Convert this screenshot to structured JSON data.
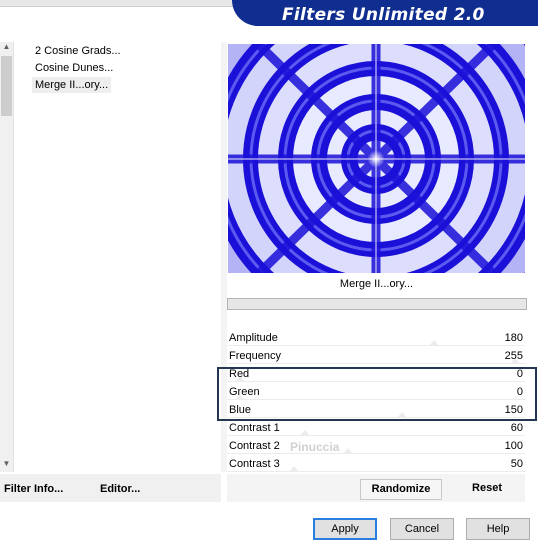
{
  "title": "Filters Unlimited 2.0",
  "filter_list": {
    "items": [
      {
        "label": "2 Cosine Grads..."
      },
      {
        "label": "Cosine Dunes..."
      },
      {
        "label": "Merge II...ory..."
      }
    ],
    "selected_index": 2
  },
  "preview": {
    "caption": "Merge II...ory...",
    "colors": {
      "dark": "#1a10d8",
      "light": "#e8eaff",
      "mid": "#5a5af0"
    }
  },
  "sliders": [
    {
      "label": "Amplitude",
      "value": "180",
      "level": 0.706
    },
    {
      "label": "Frequency",
      "value": "255",
      "level": 1.0
    },
    {
      "label": "Red",
      "value": "0",
      "level": 0.0
    },
    {
      "label": "Green",
      "value": "0",
      "level": 0.0
    },
    {
      "label": "Blue",
      "value": "150",
      "level": 0.588
    },
    {
      "label": "Contrast 1",
      "value": "60",
      "level": 0.235
    },
    {
      "label": "Contrast 2",
      "value": "100",
      "level": 0.392
    },
    {
      "label": "Contrast 3",
      "value": "50",
      "level": 0.196
    }
  ],
  "links": {
    "filter_info": "Filter Info...",
    "editor": "Editor..."
  },
  "actions": {
    "randomize": "Randomize",
    "reset": "Reset"
  },
  "buttons": {
    "apply": "Apply",
    "cancel": "Cancel",
    "help": "Help"
  },
  "watermark": "Pinuccia"
}
